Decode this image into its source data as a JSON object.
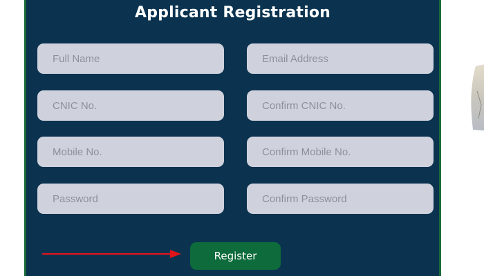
{
  "form": {
    "title": "Applicant Registration",
    "fields": {
      "full_name": {
        "placeholder": "Full Name",
        "value": ""
      },
      "email": {
        "placeholder": "Email Address",
        "value": ""
      },
      "cnic": {
        "placeholder": "CNIC No.",
        "value": ""
      },
      "confirm_cnic": {
        "placeholder": "Confirm CNIC No.",
        "value": ""
      },
      "mobile": {
        "placeholder": "Mobile No.",
        "value": ""
      },
      "confirm_mobile": {
        "placeholder": "Confirm Mobile No.",
        "value": ""
      },
      "password": {
        "placeholder": "Password",
        "value": ""
      },
      "confirm_password": {
        "placeholder": "Confirm Password",
        "value": ""
      }
    },
    "register_label": "Register"
  },
  "annotation": {
    "arrow_color": "#e0141c",
    "arrow_icon": "arrow-right-icon"
  },
  "colors": {
    "panel_background": "#0b3350",
    "panel_border": "#1b6b3a",
    "field_background": "#cfd2dc",
    "button_background": "#0e6b3b"
  }
}
